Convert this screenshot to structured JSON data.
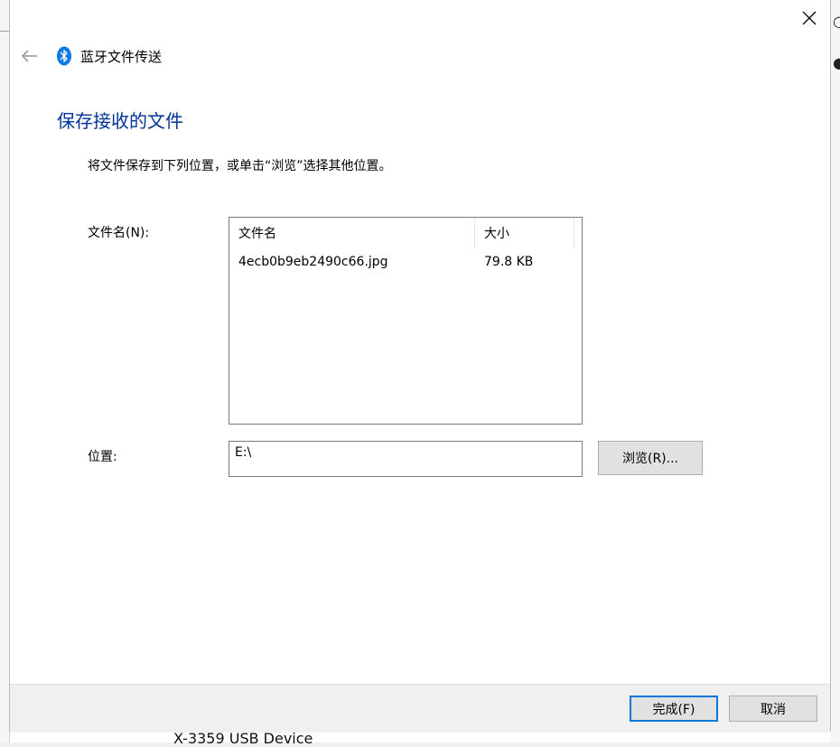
{
  "window": {
    "title": "蓝牙文件传送"
  },
  "page": {
    "heading": "保存接收的文件",
    "instruction": "将文件保存到下列位置，或单击“浏览”选择其他位置。"
  },
  "files": {
    "label": "文件名(N):",
    "columns": [
      "文件名",
      "大小"
    ],
    "rows": [
      {
        "name": "4ecb0b9eb2490c66.jpg",
        "size": "79.8 KB"
      }
    ]
  },
  "location": {
    "label": "位置:",
    "value": "E:\\",
    "browse_label": "浏览(R)..."
  },
  "footer": {
    "finish_label": "完成(F)",
    "cancel_label": "取消"
  },
  "background": {
    "bottom_text": "X-3359  USB Device"
  },
  "colors": {
    "accent": "#0078d7",
    "heading": "#003399",
    "bluetooth": "#0a7ae0"
  },
  "icons": {
    "back": "back-arrow-icon",
    "bluetooth": "bluetooth-icon",
    "close": "close-icon"
  }
}
